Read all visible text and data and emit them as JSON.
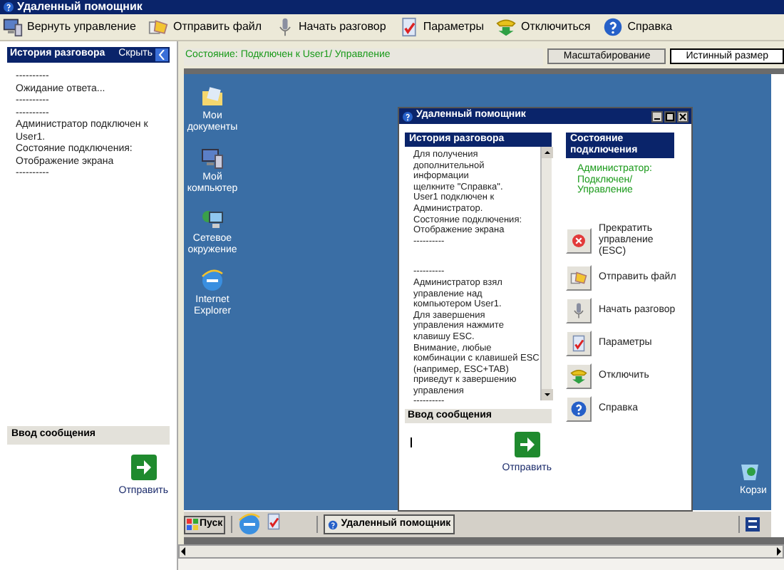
{
  "window": {
    "title": "Удаленный помощник"
  },
  "toolbar": [
    {
      "label": "Вернуть управление"
    },
    {
      "label": "Отправить файл"
    },
    {
      "label": "Начать разговор"
    },
    {
      "label": "Параметры"
    },
    {
      "label": "Отключиться"
    },
    {
      "label": "Справка"
    }
  ],
  "history_panel": {
    "title": "История разговора",
    "hide": "Скрыть",
    "lines": [
      "----------",
      "Ожидание ответа...",
      "----------",
      "----------",
      "Администратор подключен к",
      "User1.",
      "Состояние подключения:",
      "Отображение экрана",
      "----------"
    ]
  },
  "message_panel": {
    "title": "Ввод сообщения",
    "send": "Отправить"
  },
  "status": "Состояние: Подключен к User1/ Управление",
  "view_buttons": [
    {
      "label": "Масштабирование",
      "selected": false
    },
    {
      "label": "Истинный размер",
      "selected": true
    }
  ],
  "remote_desktop": {
    "icons": [
      {
        "label": "Мои документы"
      },
      {
        "label": "Мой компьютер"
      },
      {
        "label": "Сетевое окружение"
      },
      {
        "label": "Internet Explorer"
      }
    ],
    "recycle_bin": "Корзи",
    "inner_window": {
      "title": "Удаленный помощник",
      "history_title": "История разговора",
      "history": [
        {
          "text": "Для получения"
        },
        {
          "text": "дополнительной"
        },
        {
          "text": "информации"
        },
        {
          "text": "щелкните \"Справка\"."
        },
        {
          "text": "User1 подключен к"
        },
        {
          "text": "Администратор."
        },
        {
          "text": "Состояние подключения:"
        },
        {
          "text": "Отображение экрана"
        },
        {
          "text": "----------",
          "gap_after": true
        },
        {
          "text": "----------"
        },
        {
          "text": "Администратор взял"
        },
        {
          "text": "управление над"
        },
        {
          "text": "компьютером User1."
        },
        {
          "text": "Для завершения"
        },
        {
          "text": "управления нажмите"
        },
        {
          "text": "клавишу ESC."
        },
        {
          "text": "Внимание, любые"
        },
        {
          "text": "комбинации с клавишей ESC"
        },
        {
          "text": "(например, ESC+TAB)"
        },
        {
          "text": "приведут к завершению"
        },
        {
          "text": "управления"
        },
        {
          "text": "----------"
        }
      ],
      "message_title": "Ввод сообщения",
      "send": "Отправить",
      "state_title": "Состояние подключения",
      "state_lines": [
        "Администратор:",
        "Подключен/",
        "Управление"
      ],
      "actions": [
        {
          "label": "Прекратить управление (ESC)"
        },
        {
          "label": "Отправить файл"
        },
        {
          "label": "Начать разговор"
        },
        {
          "label": "Параметры"
        },
        {
          "label": "Отключить"
        },
        {
          "label": "Справка"
        }
      ]
    },
    "taskbar": {
      "start": "Пуск",
      "task": "Удаленный помощник"
    }
  }
}
